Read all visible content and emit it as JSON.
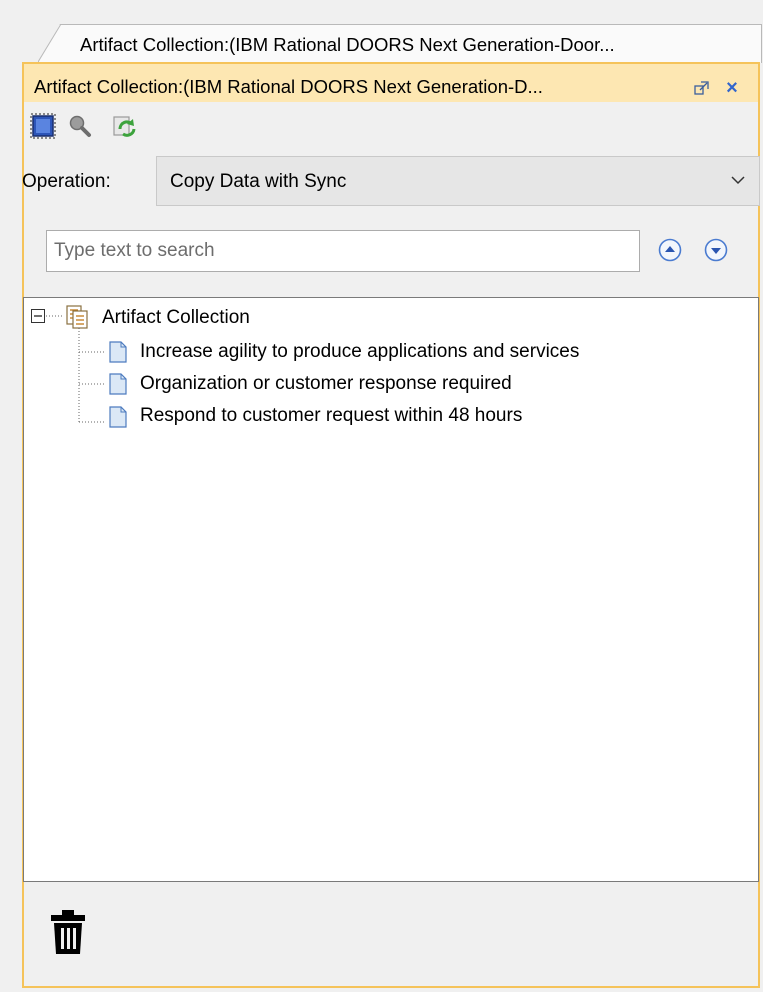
{
  "tab": {
    "label": "Artifact Collection:(IBM Rational DOORS Next Generation-Door..."
  },
  "panel": {
    "title": "Artifact Collection:(IBM Rational DOORS Next Generation-D...",
    "accent_color": "#f5c35a",
    "title_bg_color": "#fde7b2"
  },
  "toolbar": {
    "tools": [
      {
        "icon": "select-elements-icon"
      },
      {
        "icon": "search-icon"
      },
      {
        "icon": "refresh-icon"
      }
    ]
  },
  "operation": {
    "label": "Operation:",
    "value": "Copy Data with Sync"
  },
  "search": {
    "placeholder": "Type text to search"
  },
  "tree": {
    "root": {
      "label": "Artifact Collection",
      "expanded": true
    },
    "children": [
      {
        "label": "Increase agility to produce applications and services"
      },
      {
        "label": "Organization or customer response required"
      },
      {
        "label": "Respond to customer request within 48 hours"
      }
    ]
  }
}
